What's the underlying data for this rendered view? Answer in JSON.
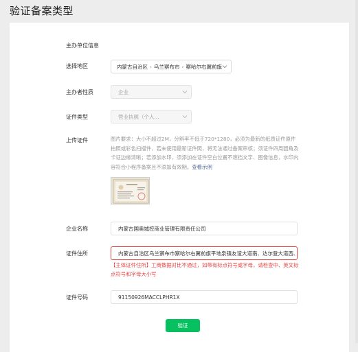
{
  "page": {
    "title": "验证备案类型"
  },
  "section": {
    "title": "主办单位信息"
  },
  "fields": {
    "region": {
      "label": "选择地区",
      "parts": [
        "内蒙古自治区",
        "乌兰察布市",
        "察哈尔右翼前旗"
      ],
      "separator": "›"
    },
    "nature": {
      "label": "主办者性质",
      "value": "企业"
    },
    "cert_type": {
      "label": "证件类型",
      "value": "营业执照（个人..."
    },
    "upload": {
      "label": "上传证件",
      "description": "图片要求：大小不超过2M，分辨率不低于720*1280，必须为最新的纸质证件原件拍照或彩色扫描件，若未使用最新证件照，将无法通过备案审核；须证件四周圆角及卡证边缘清晰；若添加水印，须添加在证件空白位置不遮挡文字、图像信息，水印内容符合小程序备案且不添加有效期。",
      "link_text": "查看示例"
    },
    "company_name": {
      "label": "企业名称",
      "value": "内蒙古国奥城控商业管理有限责任公司"
    },
    "address": {
      "label": "证件住所",
      "value": "内蒙古自治区乌兰察布市察哈尔右翼前旗平地泉镇友谊大道南、达尔登大道西、万",
      "error": "【主体证件住所】工商数据对比不通过，如带有标点符号或字母，请检查中、英文标点符号和字母大小写"
    },
    "cert_number": {
      "label": "证件号码",
      "value": "91150926MACCLPHR1X"
    }
  },
  "actions": {
    "verify_label": "验证"
  },
  "colors": {
    "primary": "#07c160",
    "error": "#e64340",
    "link": "#576b95"
  }
}
